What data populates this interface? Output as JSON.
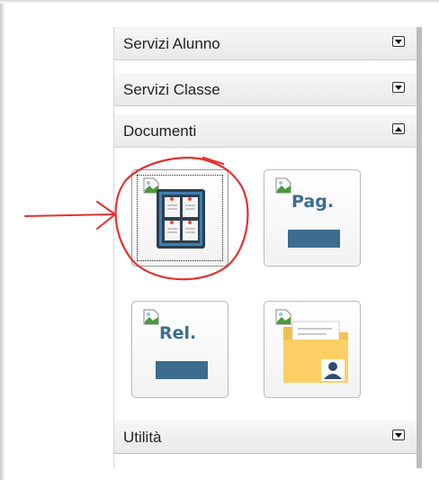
{
  "panels": [
    {
      "label": "Servizi Alunno",
      "state": "collapsed"
    },
    {
      "label": "Servizi Classe",
      "state": "collapsed"
    },
    {
      "label": "Documenti",
      "state": "expanded"
    },
    {
      "label": "Utilità",
      "state": "collapsed"
    }
  ],
  "documenti_tiles": [
    {
      "name": "bacheca",
      "icon": "bulletin-board-icon",
      "text": "",
      "selected": true
    },
    {
      "name": "pagella",
      "icon": "pagella-icon",
      "text": "Pag."
    },
    {
      "name": "relazione",
      "icon": "relazione-icon",
      "text": "Rel."
    },
    {
      "name": "cartella",
      "icon": "user-folder-icon",
      "text": ""
    }
  ],
  "colors": {
    "accent": "#3c6d8f",
    "annotation": "#e53030",
    "header_bg": "#efefef"
  }
}
